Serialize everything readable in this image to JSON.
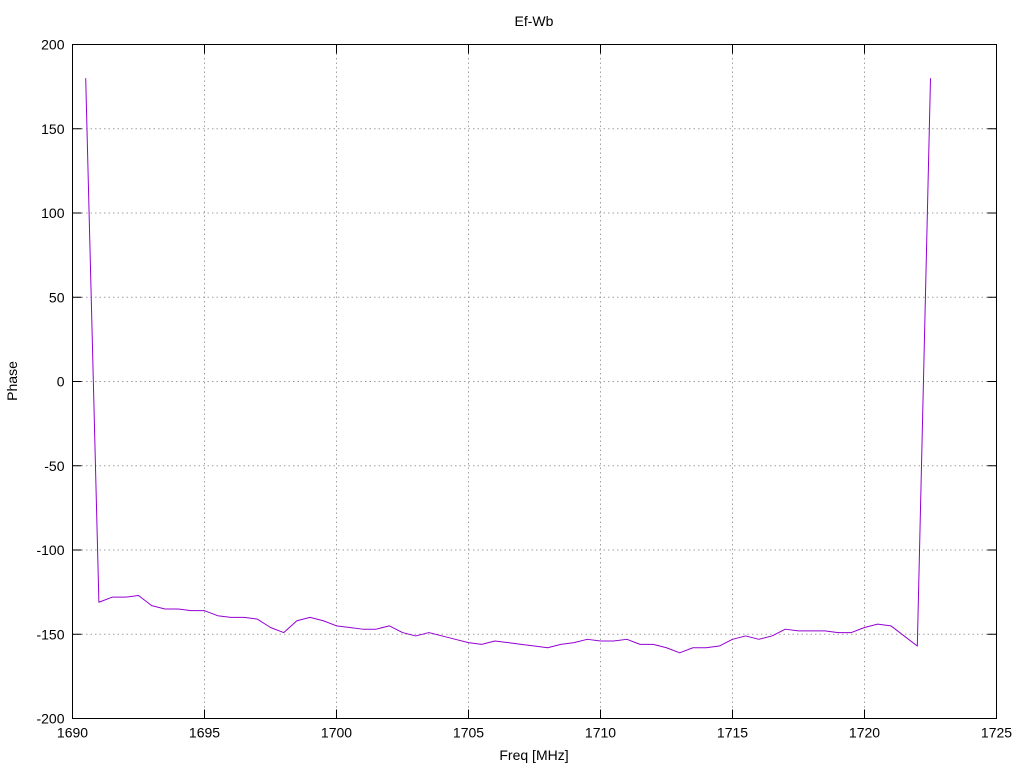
{
  "chart_data": {
    "type": "line",
    "title": "Ef-Wb",
    "xlabel": "Freq [MHz]",
    "ylabel": "Phase",
    "xlim": [
      1690,
      1725
    ],
    "ylim": [
      -200,
      200
    ],
    "xticks": [
      1690,
      1695,
      1700,
      1705,
      1710,
      1715,
      1720,
      1725
    ],
    "yticks": [
      -200,
      -150,
      -100,
      -50,
      0,
      50,
      100,
      150,
      200
    ],
    "grid": true,
    "legend": "none",
    "line_color": "#9400d3",
    "series": [
      {
        "x": [
          1690.5,
          1691.0,
          1691.5,
          1692.0,
          1692.5,
          1693.0,
          1693.5,
          1694.0,
          1694.5,
          1695.0,
          1695.5,
          1696.0,
          1696.5,
          1697.0,
          1697.5,
          1698.0,
          1698.5,
          1699.0,
          1699.5,
          1700.0,
          1700.5,
          1701.0,
          1701.5,
          1702.0,
          1702.5,
          1703.0,
          1703.5,
          1704.0,
          1704.5,
          1705.0,
          1705.5,
          1706.0,
          1706.5,
          1707.0,
          1707.5,
          1708.0,
          1708.5,
          1709.0,
          1709.5,
          1710.0,
          1710.5,
          1711.0,
          1711.5,
          1712.0,
          1712.5,
          1713.0,
          1713.5,
          1714.0,
          1714.5,
          1715.0,
          1715.5,
          1716.0,
          1716.5,
          1717.0,
          1717.5,
          1718.0,
          1718.5,
          1719.0,
          1719.5,
          1720.0,
          1720.5,
          1721.0,
          1721.5,
          1722.0,
          1722.5
        ],
        "y": [
          180,
          -131,
          -128,
          -128,
          -127,
          -133,
          -135,
          -135,
          -136,
          -136,
          -139,
          -140,
          -140,
          -141,
          -146,
          -149,
          -142,
          -140,
          -142,
          -145,
          -146,
          -147,
          -147,
          -145,
          -149,
          -151,
          -149,
          -151,
          -153,
          -155,
          -156,
          -154,
          -155,
          -156,
          -157,
          -158,
          -156,
          -155,
          -153,
          -154,
          -154,
          -153,
          -156,
          -156,
          -158,
          -161,
          -158,
          -158,
          -157,
          -153,
          -151,
          -153,
          -151,
          -147,
          -148,
          -148,
          -148,
          -149,
          -149,
          -146,
          -144,
          -145,
          -151,
          -157,
          180
        ]
      }
    ]
  }
}
